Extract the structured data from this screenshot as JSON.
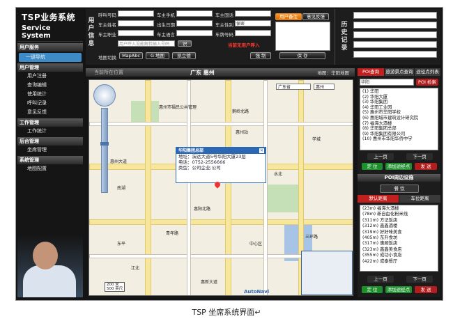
{
  "sidebar": {
    "brand_line1": "TSP业务系统",
    "brand_line2": "Service System",
    "sections": [
      {
        "title": "用户服务",
        "items": [
          "一键导航"
        ]
      },
      {
        "title": "用户管理",
        "items": [
          "用户注册",
          "查询编辑",
          "使用统计",
          "呼叫记录",
          "意见反馈"
        ]
      },
      {
        "title": "工作管理",
        "items": [
          "工作统计"
        ]
      },
      {
        "title": "后台管理",
        "items": [
          "坐席管理"
        ]
      },
      {
        "title": "系统管理",
        "items": [
          "地图配置"
        ]
      }
    ],
    "selected_item": "一键导航"
  },
  "user_info": {
    "vertical_label": "用户信息",
    "rows": [
      [
        "呼叫号码",
        "车主手机",
        "车主固话"
      ],
      [
        "车主姓名",
        "出生日期",
        "车主性别"
      ],
      [
        "车主职业",
        "车主语言",
        "车牌号码"
      ]
    ],
    "gender_value": "保密",
    "remark_placeholder": "用户呼入没能解找输入号码",
    "identify_label": "识",
    "warning_text": "当前无用户呼入",
    "map_switch_label": "地图切换",
    "map_buttons": [
      "MapAbc",
      "G 地图",
      "凯立德"
    ],
    "force_button": "强 制"
  },
  "remark": {
    "tabs": [
      "用户备注",
      "意见反馈"
    ],
    "save_label": "保 存",
    "tiny_label": "C"
  },
  "history": {
    "vertical_label": "历史记录"
  },
  "map": {
    "location_label": "当前所在位置",
    "location_value": "广东 惠州",
    "map_source": "地图：华阳地图",
    "province_select": "广东省",
    "city_select": "惠州",
    "popup": {
      "title": "华阳集团总部",
      "address": "地址：演达大道5号华阳大厦23层",
      "phone": "电话：0752-2556666",
      "type": "类型：公司企业;公司"
    },
    "scale": [
      "200 米",
      "500 英尺"
    ],
    "logo": "AutoNavi",
    "labels": [
      "惠州市福民公共管理",
      "惠州站",
      "南湖",
      "学城",
      "惠阳北路",
      "惠州大道",
      "中心区",
      "江北",
      "鹅岭北路",
      "三环路",
      "青年路",
      "惠新大道",
      "水北",
      "东平"
    ]
  },
  "poi": {
    "tabs": [
      "POI查询",
      "旅游景点查询",
      "途径点列表"
    ],
    "search_value": "华阳",
    "search_button": "POI 检索",
    "results": [
      "(1) 华阳",
      "(2) 华阳大厦",
      "(3) 华阳集团",
      "(4) 华阳工业园",
      "(5) 惠州市华阳学校",
      "(6) 惠阳城市建筑设计研究院",
      "(7) 福海大酒楼",
      "(8) 华阳集团总部",
      "(9) 华阳集团有限公司",
      "(10) 惠州市华阳华侨中学"
    ],
    "prev": "上一页",
    "next": "下一页",
    "locate": "定 位",
    "add_waypoint": "添加途经点",
    "send": "发 送",
    "around_title": "POI周边设施",
    "around_select": "餐 饮",
    "sort_tabs": [
      "默认距离",
      "车位距离"
    ],
    "around_results": [
      "(23m) 福海大酒楼",
      "(78m) 新自由化粉米线",
      "(311m) 方记饭店",
      "(312m) 鑫鑫酒楼",
      "(319m) 好好味美食",
      "(405m) 东升食坊",
      "(317m) 惠顺饭店",
      "(323m) 鑫鑫美食店",
      "(355m) 成功小食店",
      "(422m) 成泰餐厅"
    ]
  },
  "caption": "TSP 坐席系统界面↵"
}
